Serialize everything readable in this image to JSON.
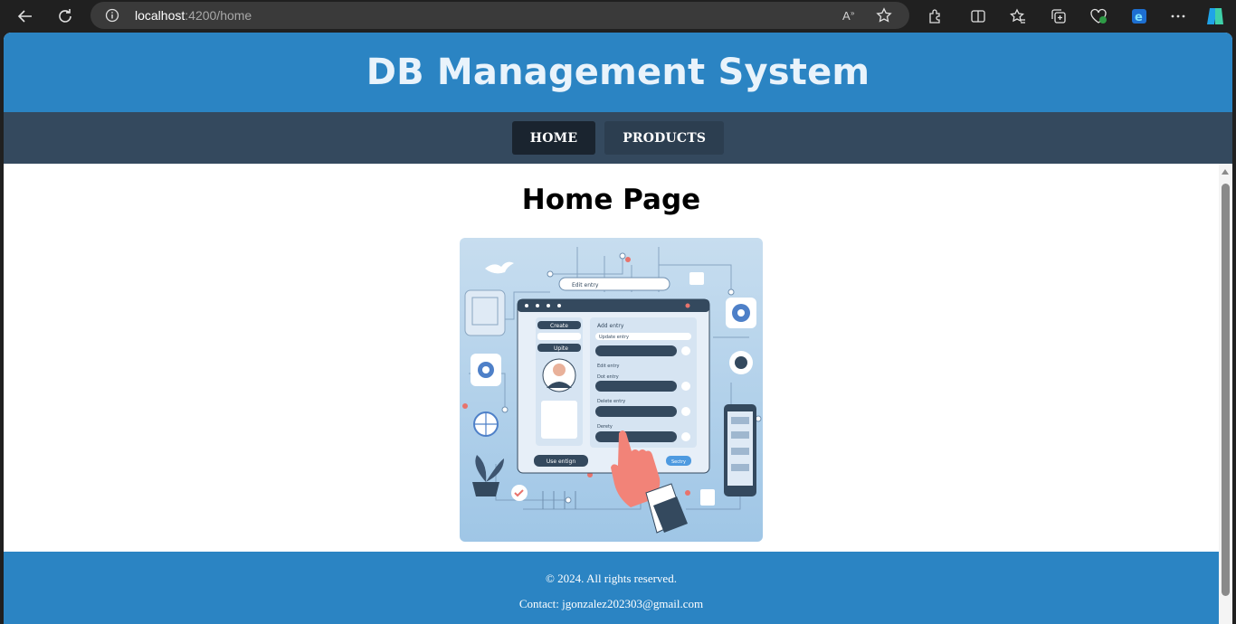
{
  "browser": {
    "url_host": "localhost",
    "url_path": ":4200/home"
  },
  "site": {
    "title": "DB Management System"
  },
  "nav": {
    "items": [
      {
        "label": "HOME",
        "active": true
      },
      {
        "label": "PRODUCTS",
        "active": false
      }
    ]
  },
  "main": {
    "heading": "Home Page",
    "image_text": {
      "search": "Edit entry",
      "create": "Create",
      "update": "Upite",
      "add_entry": "Add entry",
      "update_entry": "Update entry",
      "edit_entry": "Edit entry",
      "dots_entry": "Dot entry",
      "delete_entry": "Delete entry",
      "destroy": "Derety",
      "use": "Use entign",
      "save": "Sectry"
    }
  },
  "footer": {
    "copyright": "© 2024. All rights reserved.",
    "contact": "Contact: jgonzalez202303@gmail.com"
  },
  "colors": {
    "header_blue": "#2b84c3",
    "nav_dark": "#34495e",
    "nav_active": "#1a242f"
  },
  "icons": [
    "back-icon",
    "refresh-icon",
    "info-icon",
    "read-aloud-icon",
    "favorite-icon",
    "extensions-icon",
    "split-screen-icon",
    "favorites-icon",
    "collections-icon",
    "browser-essentials-icon",
    "edge-icon",
    "more-icon",
    "copilot-icon"
  ]
}
